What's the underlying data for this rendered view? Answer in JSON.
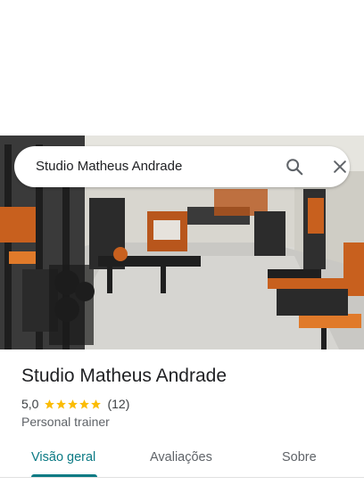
{
  "search": {
    "query": "Studio Matheus Andrade"
  },
  "place": {
    "name": "Studio Matheus Andrade",
    "rating": "5,0",
    "rating_stars": 5,
    "review_count": "(12)",
    "category": "Personal trainer"
  },
  "tabs": [
    {
      "label": "Visão geral",
      "active": true
    },
    {
      "label": "Avaliações",
      "active": false
    },
    {
      "label": "Sobre",
      "active": false
    }
  ],
  "colors": {
    "accent": "#0b7a84",
    "star": "#fbbc04",
    "text_primary": "#202124",
    "text_secondary": "#5f6368"
  },
  "icons": {
    "search": "search-icon",
    "close": "close-icon",
    "star": "star-icon"
  }
}
